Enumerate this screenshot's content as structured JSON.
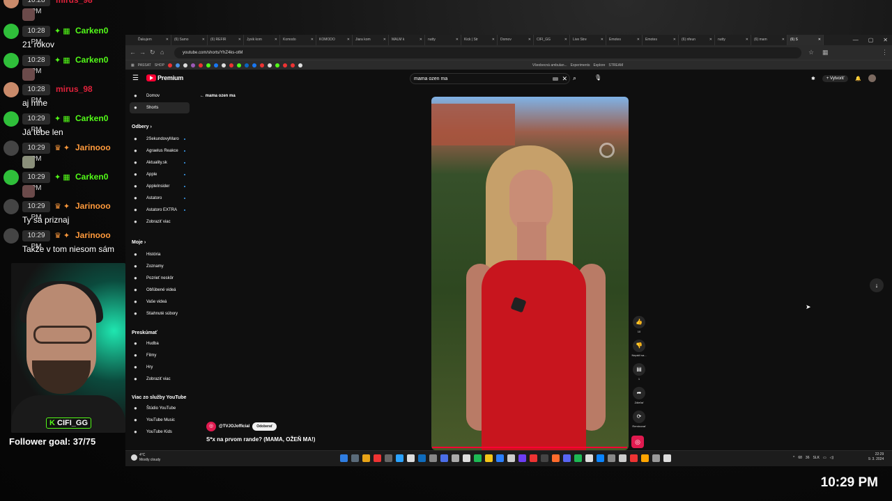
{
  "chat": {
    "messages": [
      {
        "time": "10:28 PM",
        "user": "mirus_98",
        "user_color": "#e0223b",
        "badges": "",
        "text": "",
        "emote": true
      },
      {
        "time": "10:28 PM",
        "user": "Carken0",
        "user_color": "#53fc18",
        "badges": "✦ ▦",
        "text": "21 rokov",
        "emote": false
      },
      {
        "time": "10:28 PM",
        "user": "Carken0",
        "user_color": "#53fc18",
        "badges": "✦ ▦",
        "text": "",
        "emote": true
      },
      {
        "time": "10:28 PM",
        "user": "mirus_98",
        "user_color": "#e0223b",
        "badges": "",
        "text": "aj mne",
        "emote": false
      },
      {
        "time": "10:29 PM",
        "user": "Carken0",
        "user_color": "#53fc18",
        "badges": "✦ ▦",
        "text": "Já tebe len",
        "emote": false
      },
      {
        "time": "10:29 PM",
        "user": "Jarinooo",
        "user_color": "#ff9a3c",
        "badges": "♛ ✦",
        "text": "",
        "emote": true
      },
      {
        "time": "10:29 PM",
        "user": "Carken0",
        "user_color": "#53fc18",
        "badges": "✦ ▦",
        "text": "",
        "emote": true
      },
      {
        "time": "10:29 PM",
        "user": "Jarinooo",
        "user_color": "#ff9a3c",
        "badges": "♛ ✦",
        "text": "Ty sa priznaj",
        "emote": false
      },
      {
        "time": "10:29 PM",
        "user": "Jarinooo",
        "user_color": "#ff9a3c",
        "badges": "♛ ✦",
        "text": "Takže v tom niesom sám",
        "emote": false
      }
    ],
    "webcam_tag_k": "K",
    "webcam_tag": "CIFI_GG",
    "follower_goal": "Follower goal: 37/75",
    "stream_clock": "10:29 PM"
  },
  "browser": {
    "tabs": [
      "Ďakujem",
      "(6) Samo",
      "(6) REFIR",
      "Jyxik kom",
      "Komodo",
      "KOMODO",
      "Jiara kom",
      "MALM k",
      "nutty",
      "Kick | Str",
      "Domov",
      "CIFI_GG",
      "Live Stre",
      "Emotes",
      "Emotes",
      "(6) nfeun",
      "nutty",
      "(6) mam",
      "(6) S"
    ],
    "active_tab": 18,
    "window_controls": [
      "—",
      "▢",
      "✕"
    ],
    "url": "youtube.com/shorts/YhZ4ks-otM",
    "bookmarks": [
      "PASSAT",
      "SHOP",
      "Všeobecná ambulan...",
      "Experiments",
      "Explore",
      "STREAM"
    ]
  },
  "youtube": {
    "logo_text": "Premium",
    "search_value": "mama ozen ma",
    "create_label": "Vytvoriť",
    "back_label": "mama ozen ma",
    "sidebar": {
      "main": [
        {
          "label": "Domov",
          "icon": "home-icon"
        },
        {
          "label": "Shorts",
          "icon": "shorts-icon"
        }
      ],
      "subs_head": "Odbery",
      "subs": [
        "2SekundovyMaro",
        "Agraelus Reakce",
        "Aktuality.sk",
        "Apple",
        "AppleInsider",
        "Astatoro",
        "Astatoro EXTRA",
        "Zobraziť viac"
      ],
      "you_head": "Moje",
      "you": [
        "História",
        "Zoznamy",
        "Pozrieť neskôr",
        "Obľúbené videá",
        "Vaše videá",
        "Stiahnuté súbory"
      ],
      "explore_head": "Preskúmať",
      "explore": [
        "Hudba",
        "Filmy",
        "Hry",
        "Zobraziť viac"
      ],
      "more_head": "Viac zo služby YouTube",
      "more": [
        "Štúdio YouTube",
        "YouTube Music",
        "YouTube Kids"
      ]
    },
    "short": {
      "channel": "@TVJOJofficial",
      "subscribe_label": "Odoberať",
      "title": "S*x na prvom rande? (MAMA, OŽEŇ MA!)",
      "like_count": "10",
      "dislike_label": "Nepáči sa...",
      "comment_count": "1",
      "share_label": "Zdieľať",
      "remix_label": "Remixovať"
    }
  },
  "taskbar": {
    "weather_temp": "4°C",
    "weather_desc": "Mostly cloudy",
    "tray": [
      "68",
      "36",
      "SLK"
    ],
    "time": "22:29",
    "date": "9. 3. 2024"
  }
}
